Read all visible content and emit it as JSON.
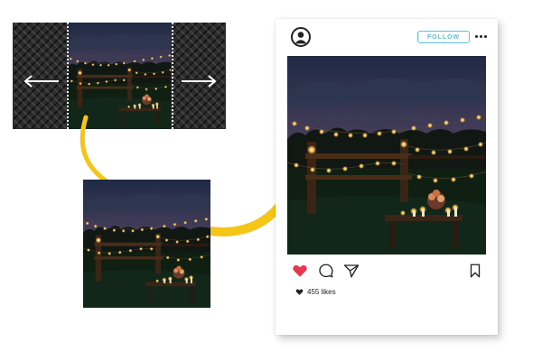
{
  "post": {
    "follow_label": "FOLLOW",
    "likes_text": "455 likes"
  },
  "icons": {
    "avatar": "user-circle-icon",
    "more": "more-horizontal-icon",
    "like": "heart-filled-icon",
    "comment": "comment-bubble-icon",
    "share": "paper-plane-icon",
    "save": "bookmark-icon",
    "crop_left": "arrow-left-icon",
    "crop_right": "arrow-right-icon"
  },
  "colors": {
    "like_red": "#e8384f",
    "follow_accent": "#5cc1d6",
    "flow_arrow_yellow": "#f5c518"
  }
}
